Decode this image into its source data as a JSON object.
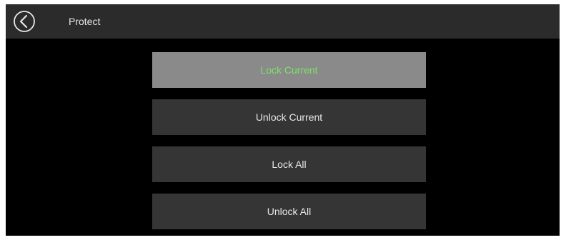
{
  "header": {
    "title": "Protect",
    "back_icon": "back-arrow-circle-icon"
  },
  "menu": {
    "items": [
      {
        "label": "Lock Current",
        "selected": true
      },
      {
        "label": "Unlock Current",
        "selected": false
      },
      {
        "label": "Lock All",
        "selected": false
      },
      {
        "label": "Unlock All",
        "selected": false
      }
    ]
  },
  "colors": {
    "screen_background": "#000000",
    "header_background": "#2b2b2b",
    "button_background": "#353535",
    "selected_background": "#8a8a8a",
    "selected_text": "#7fe06a",
    "text": "#e8e8e8"
  }
}
